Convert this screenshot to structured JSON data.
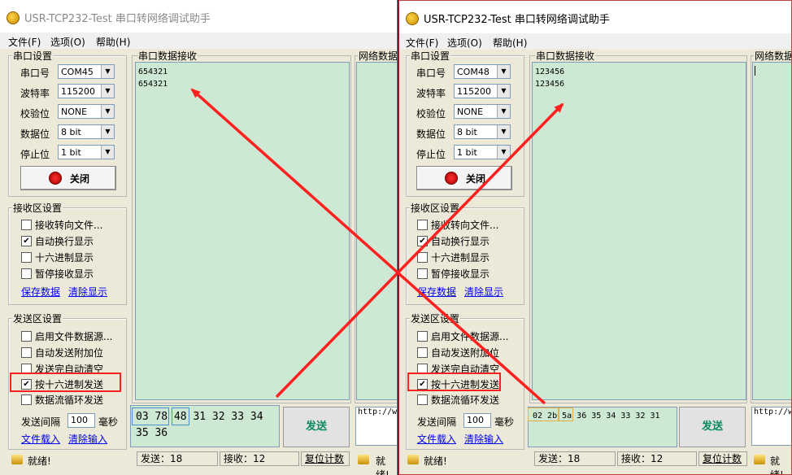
{
  "app": {
    "title": "USR-TCP232-Test 串口转网络调试助手",
    "menu": [
      "文件(F)",
      "选项(O)",
      "帮助(H)"
    ]
  },
  "serial_settings": {
    "title": "串口设置",
    "labels": [
      "串口号",
      "波特率",
      "校验位",
      "数据位",
      "停止位"
    ],
    "close_button": "关闭"
  },
  "receive_settings": {
    "title": "接收区设置",
    "options": [
      "接收转向文件...",
      "自动换行显示",
      "十六进制显示",
      "暂停接收显示"
    ],
    "checked": [
      false,
      true,
      false,
      false
    ],
    "save_link": "保存数据",
    "clear_link": "清除显示"
  },
  "send_settings": {
    "title": "发送区设置",
    "options": [
      "启用文件数据源...",
      "自动发送附加位",
      "发送完自动清空",
      "按十六进制发送",
      "数据流循环发送"
    ],
    "checked": [
      false,
      false,
      false,
      true,
      false
    ],
    "interval_label": "发送间隔",
    "interval_value": "100",
    "interval_unit": "毫秒",
    "load_link": "文件载入",
    "clear_link": "清除输入"
  },
  "serial_rx_title": "串口数据接收",
  "net_rx_title": "网络数据",
  "send_button": "发送",
  "url_text": "http://w",
  "status": {
    "ready": "就绪!",
    "reset": "复位计数"
  },
  "window_a": {
    "port": "COM45",
    "baud": "115200",
    "parity": "NONE",
    "databits": "8 bit",
    "stopbits": "1 bit",
    "rx_lines": [
      "654321",
      "654321"
    ],
    "tx_line1": "03 78 48 31 32 33 34",
    "tx_line2": "35 36",
    "sent": "发送：18",
    "received": "接收：12"
  },
  "window_b": {
    "port": "COM48",
    "baud": "115200",
    "parity": "NONE",
    "databits": "8 bit",
    "stopbits": "1 bit",
    "rx_lines": [
      "123456",
      "123456"
    ],
    "tx_line1": "02 2b 5a 36 35 34 33 32 31",
    "sent": "发送：18",
    "received": "接收：12"
  },
  "colors": {
    "window_bg": "#ece9d8",
    "rx_bg": "#cde8d3",
    "annotation_red": "#ff2020",
    "send_text": "#0a8a60"
  }
}
